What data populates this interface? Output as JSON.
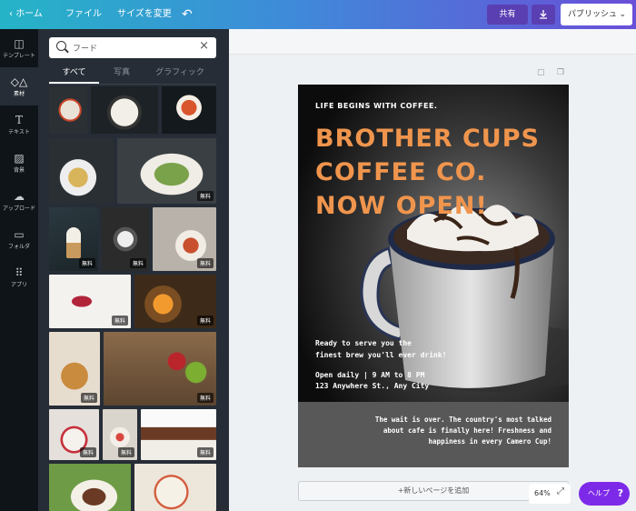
{
  "topbar": {
    "home_label": "ホーム",
    "file_label": "ファイル",
    "resize_label": "サイズを変更",
    "undo_icon": "undo-icon",
    "share_label": "共有",
    "download_icon": "download-icon",
    "publish_label": "パブリッシュ"
  },
  "rail": {
    "items": [
      {
        "label": "テンプレート",
        "icon": "template-icon"
      },
      {
        "label": "素材",
        "icon": "elements-icon",
        "active": true
      },
      {
        "label": "テキスト",
        "icon": "text-icon"
      },
      {
        "label": "背景",
        "icon": "background-icon"
      },
      {
        "label": "アップロード",
        "icon": "upload-icon"
      },
      {
        "label": "フォルダ",
        "icon": "folder-icon"
      },
      {
        "label": "アプリ",
        "icon": "apps-icon"
      }
    ]
  },
  "panel": {
    "search_value": "フード",
    "tabs": [
      "すべて",
      "写真",
      "グラフィック"
    ],
    "free_label": "無料"
  },
  "poster": {
    "tagline": "LIFE BEGINS WITH COFFEE.",
    "headline": [
      "BROTHER CUPS",
      "COFFEE CO.",
      "NOW OPEN!"
    ],
    "ready_line1": "Ready to serve you the",
    "ready_line2": "finest brew you'll ever drink!",
    "hours": "Open daily | 9 AM to 8 PM",
    "address": "123 Anywhere St., Any City",
    "blurb": [
      "The wait is over. The country's most talked",
      "about cafe is finally here! Freshness and",
      "happiness in every Camero Cup!"
    ],
    "colors": {
      "headline": "#f0954d",
      "bottom": "#585858"
    }
  },
  "canvas": {
    "add_page_label": "+新しいページを追加",
    "zoom": "64%",
    "help_label": "ヘルプ",
    "help_icon": "?"
  }
}
